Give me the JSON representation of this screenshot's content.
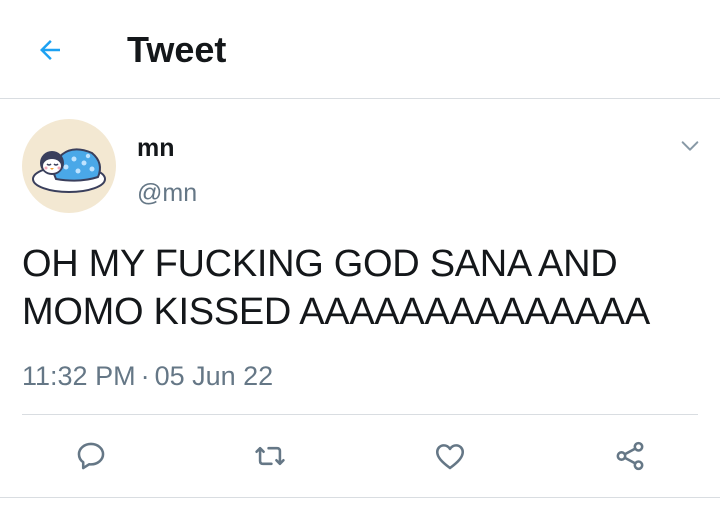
{
  "header": {
    "title": "Tweet",
    "back_icon": "arrow-left-icon",
    "accent_color": "#1da1f2"
  },
  "tweet": {
    "author": {
      "display_name": "mn",
      "handle": "@mn",
      "avatar_icon": "sleeping-penguin-avatar"
    },
    "text": "OH MY FUCKING GOD SANA AND MOMO KISSED AAAAAAAAAAAAAA",
    "time": "11:32 PM",
    "separator": "·",
    "date": "05 Jun 22",
    "menu_icon": "chevron-down-icon"
  },
  "actions": [
    {
      "name": "reply",
      "icon": "reply-icon"
    },
    {
      "name": "retweet",
      "icon": "retweet-icon"
    },
    {
      "name": "like",
      "icon": "heart-icon"
    },
    {
      "name": "share",
      "icon": "share-icon"
    }
  ],
  "colors": {
    "text_primary": "#14171a",
    "text_secondary": "#657786",
    "border": "#d9dde1"
  }
}
